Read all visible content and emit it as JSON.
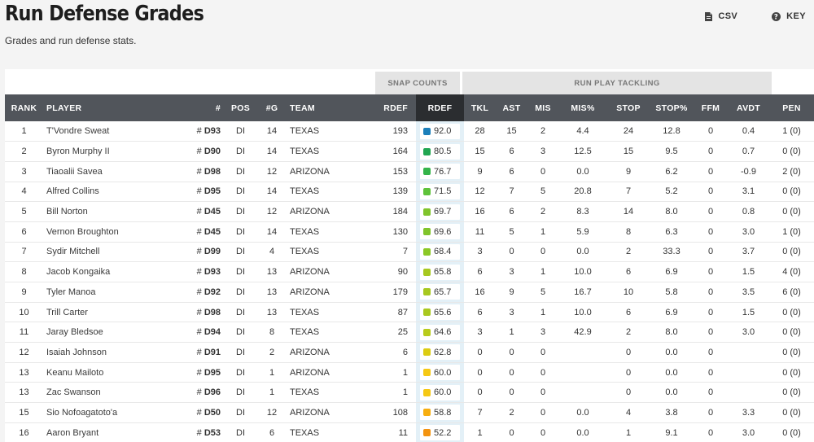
{
  "header": {
    "title": "Run Defense Grades",
    "subtitle": "Grades and run defense stats.",
    "csv_label": "CSV",
    "key_label": "KEY"
  },
  "groups": {
    "snap_counts": "SNAP COUNTS",
    "run_play_tackling": "RUN PLAY TACKLING"
  },
  "columns": {
    "rank": "RANK",
    "player": "PLAYER",
    "jersey": "#",
    "pos": "POS",
    "games": "#G",
    "team": "TEAM",
    "rdef_snaps": "RDEF",
    "rdef_grade": "RDEF",
    "tkl": "TKL",
    "ast": "AST",
    "mis": "MIS",
    "mis_pct": "MIS%",
    "stop": "STOP",
    "stop_pct": "STOP%",
    "ffm": "FFM",
    "avdt": "AVDT",
    "pen": "PEN"
  },
  "grade_colors": {
    "92.0": "#1b7fba",
    "80.5": "#21a651",
    "76.7": "#34b44a",
    "71.5": "#5ec23a",
    "69.7": "#80c42b",
    "69.6": "#80c42b",
    "68.4": "#8cc825",
    "65.8": "#a7c81f",
    "65.7": "#a7c81f",
    "65.6": "#aac81f",
    "64.6": "#b8cb1b",
    "62.8": "#dccc12",
    "60.0": "#f5c814",
    "58.8": "#f7ae0f",
    "52.2": "#f39410"
  },
  "rows": [
    {
      "rank": "1",
      "player": "T'Vondre Sweat",
      "jersey": "D93",
      "pos": "DI",
      "g": "14",
      "team": "TEXAS",
      "rdef": "193",
      "grade": "92.0",
      "tkl": "28",
      "ast": "15",
      "mis": "2",
      "mis_pct": "4.4",
      "stop": "24",
      "stop_pct": "12.8",
      "ffm": "0",
      "avdt": "0.4",
      "pen": "1 (0)"
    },
    {
      "rank": "2",
      "player": "Byron Murphy II",
      "jersey": "D90",
      "pos": "DI",
      "g": "14",
      "team": "TEXAS",
      "rdef": "164",
      "grade": "80.5",
      "tkl": "15",
      "ast": "6",
      "mis": "3",
      "mis_pct": "12.5",
      "stop": "15",
      "stop_pct": "9.5",
      "ffm": "0",
      "avdt": "0.7",
      "pen": "0 (0)"
    },
    {
      "rank": "3",
      "player": "Tiaoalii Savea",
      "jersey": "D98",
      "pos": "DI",
      "g": "12",
      "team": "ARIZONA",
      "rdef": "153",
      "grade": "76.7",
      "tkl": "9",
      "ast": "6",
      "mis": "0",
      "mis_pct": "0.0",
      "stop": "9",
      "stop_pct": "6.2",
      "ffm": "0",
      "avdt": "-0.9",
      "pen": "2 (0)"
    },
    {
      "rank": "4",
      "player": "Alfred Collins",
      "jersey": "D95",
      "pos": "DI",
      "g": "14",
      "team": "TEXAS",
      "rdef": "139",
      "grade": "71.5",
      "tkl": "12",
      "ast": "7",
      "mis": "5",
      "mis_pct": "20.8",
      "stop": "7",
      "stop_pct": "5.2",
      "ffm": "0",
      "avdt": "3.1",
      "pen": "0 (0)"
    },
    {
      "rank": "5",
      "player": "Bill Norton",
      "jersey": "D45",
      "pos": "DI",
      "g": "12",
      "team": "ARIZONA",
      "rdef": "184",
      "grade": "69.7",
      "tkl": "16",
      "ast": "6",
      "mis": "2",
      "mis_pct": "8.3",
      "stop": "14",
      "stop_pct": "8.0",
      "ffm": "0",
      "avdt": "0.8",
      "pen": "0 (0)"
    },
    {
      "rank": "6",
      "player": "Vernon Broughton",
      "jersey": "D45",
      "pos": "DI",
      "g": "14",
      "team": "TEXAS",
      "rdef": "130",
      "grade": "69.6",
      "tkl": "11",
      "ast": "5",
      "mis": "1",
      "mis_pct": "5.9",
      "stop": "8",
      "stop_pct": "6.3",
      "ffm": "0",
      "avdt": "3.0",
      "pen": "1 (0)"
    },
    {
      "rank": "7",
      "player": "Sydir Mitchell",
      "jersey": "D99",
      "pos": "DI",
      "g": "4",
      "team": "TEXAS",
      "rdef": "7",
      "grade": "68.4",
      "tkl": "3",
      "ast": "0",
      "mis": "0",
      "mis_pct": "0.0",
      "stop": "2",
      "stop_pct": "33.3",
      "ffm": "0",
      "avdt": "3.7",
      "pen": "0 (0)"
    },
    {
      "rank": "8",
      "player": "Jacob Kongaika",
      "jersey": "D93",
      "pos": "DI",
      "g": "13",
      "team": "ARIZONA",
      "rdef": "90",
      "grade": "65.8",
      "tkl": "6",
      "ast": "3",
      "mis": "1",
      "mis_pct": "10.0",
      "stop": "6",
      "stop_pct": "6.9",
      "ffm": "0",
      "avdt": "1.5",
      "pen": "4 (0)"
    },
    {
      "rank": "9",
      "player": "Tyler Manoa",
      "jersey": "D92",
      "pos": "DI",
      "g": "13",
      "team": "ARIZONA",
      "rdef": "179",
      "grade": "65.7",
      "tkl": "16",
      "ast": "9",
      "mis": "5",
      "mis_pct": "16.7",
      "stop": "10",
      "stop_pct": "5.8",
      "ffm": "0",
      "avdt": "3.5",
      "pen": "6 (0)"
    },
    {
      "rank": "10",
      "player": "Trill Carter",
      "jersey": "D98",
      "pos": "DI",
      "g": "13",
      "team": "TEXAS",
      "rdef": "87",
      "grade": "65.6",
      "tkl": "6",
      "ast": "3",
      "mis": "1",
      "mis_pct": "10.0",
      "stop": "6",
      "stop_pct": "6.9",
      "ffm": "0",
      "avdt": "1.5",
      "pen": "0 (0)"
    },
    {
      "rank": "11",
      "player": "Jaray Bledsoe",
      "jersey": "D94",
      "pos": "DI",
      "g": "8",
      "team": "TEXAS",
      "rdef": "25",
      "grade": "64.6",
      "tkl": "3",
      "ast": "1",
      "mis": "3",
      "mis_pct": "42.9",
      "stop": "2",
      "stop_pct": "8.0",
      "ffm": "0",
      "avdt": "3.0",
      "pen": "0 (0)"
    },
    {
      "rank": "12",
      "player": "Isaiah Johnson",
      "jersey": "D91",
      "pos": "DI",
      "g": "2",
      "team": "ARIZONA",
      "rdef": "6",
      "grade": "62.8",
      "tkl": "0",
      "ast": "0",
      "mis": "0",
      "mis_pct": "",
      "stop": "0",
      "stop_pct": "0.0",
      "ffm": "0",
      "avdt": "",
      "pen": "0 (0)"
    },
    {
      "rank": "13",
      "player": "Keanu Mailoto",
      "jersey": "D95",
      "pos": "DI",
      "g": "1",
      "team": "ARIZONA",
      "rdef": "1",
      "grade": "60.0",
      "tkl": "0",
      "ast": "0",
      "mis": "0",
      "mis_pct": "",
      "stop": "0",
      "stop_pct": "0.0",
      "ffm": "0",
      "avdt": "",
      "pen": "0 (0)"
    },
    {
      "rank": "13",
      "player": "Zac Swanson",
      "jersey": "D96",
      "pos": "DI",
      "g": "1",
      "team": "TEXAS",
      "rdef": "1",
      "grade": "60.0",
      "tkl": "0",
      "ast": "0",
      "mis": "0",
      "mis_pct": "",
      "stop": "0",
      "stop_pct": "0.0",
      "ffm": "0",
      "avdt": "",
      "pen": "0 (0)"
    },
    {
      "rank": "15",
      "player": "Sio Nofoagatoto'a",
      "jersey": "D50",
      "pos": "DI",
      "g": "12",
      "team": "ARIZONA",
      "rdef": "108",
      "grade": "58.8",
      "tkl": "7",
      "ast": "2",
      "mis": "0",
      "mis_pct": "0.0",
      "stop": "4",
      "stop_pct": "3.8",
      "ffm": "0",
      "avdt": "3.3",
      "pen": "0 (0)"
    },
    {
      "rank": "16",
      "player": "Aaron Bryant",
      "jersey": "D53",
      "pos": "DI",
      "g": "6",
      "team": "TEXAS",
      "rdef": "11",
      "grade": "52.2",
      "tkl": "1",
      "ast": "0",
      "mis": "0",
      "mis_pct": "0.0",
      "stop": "1",
      "stop_pct": "9.1",
      "ffm": "0",
      "avdt": "3.0",
      "pen": "0 (0)"
    }
  ]
}
